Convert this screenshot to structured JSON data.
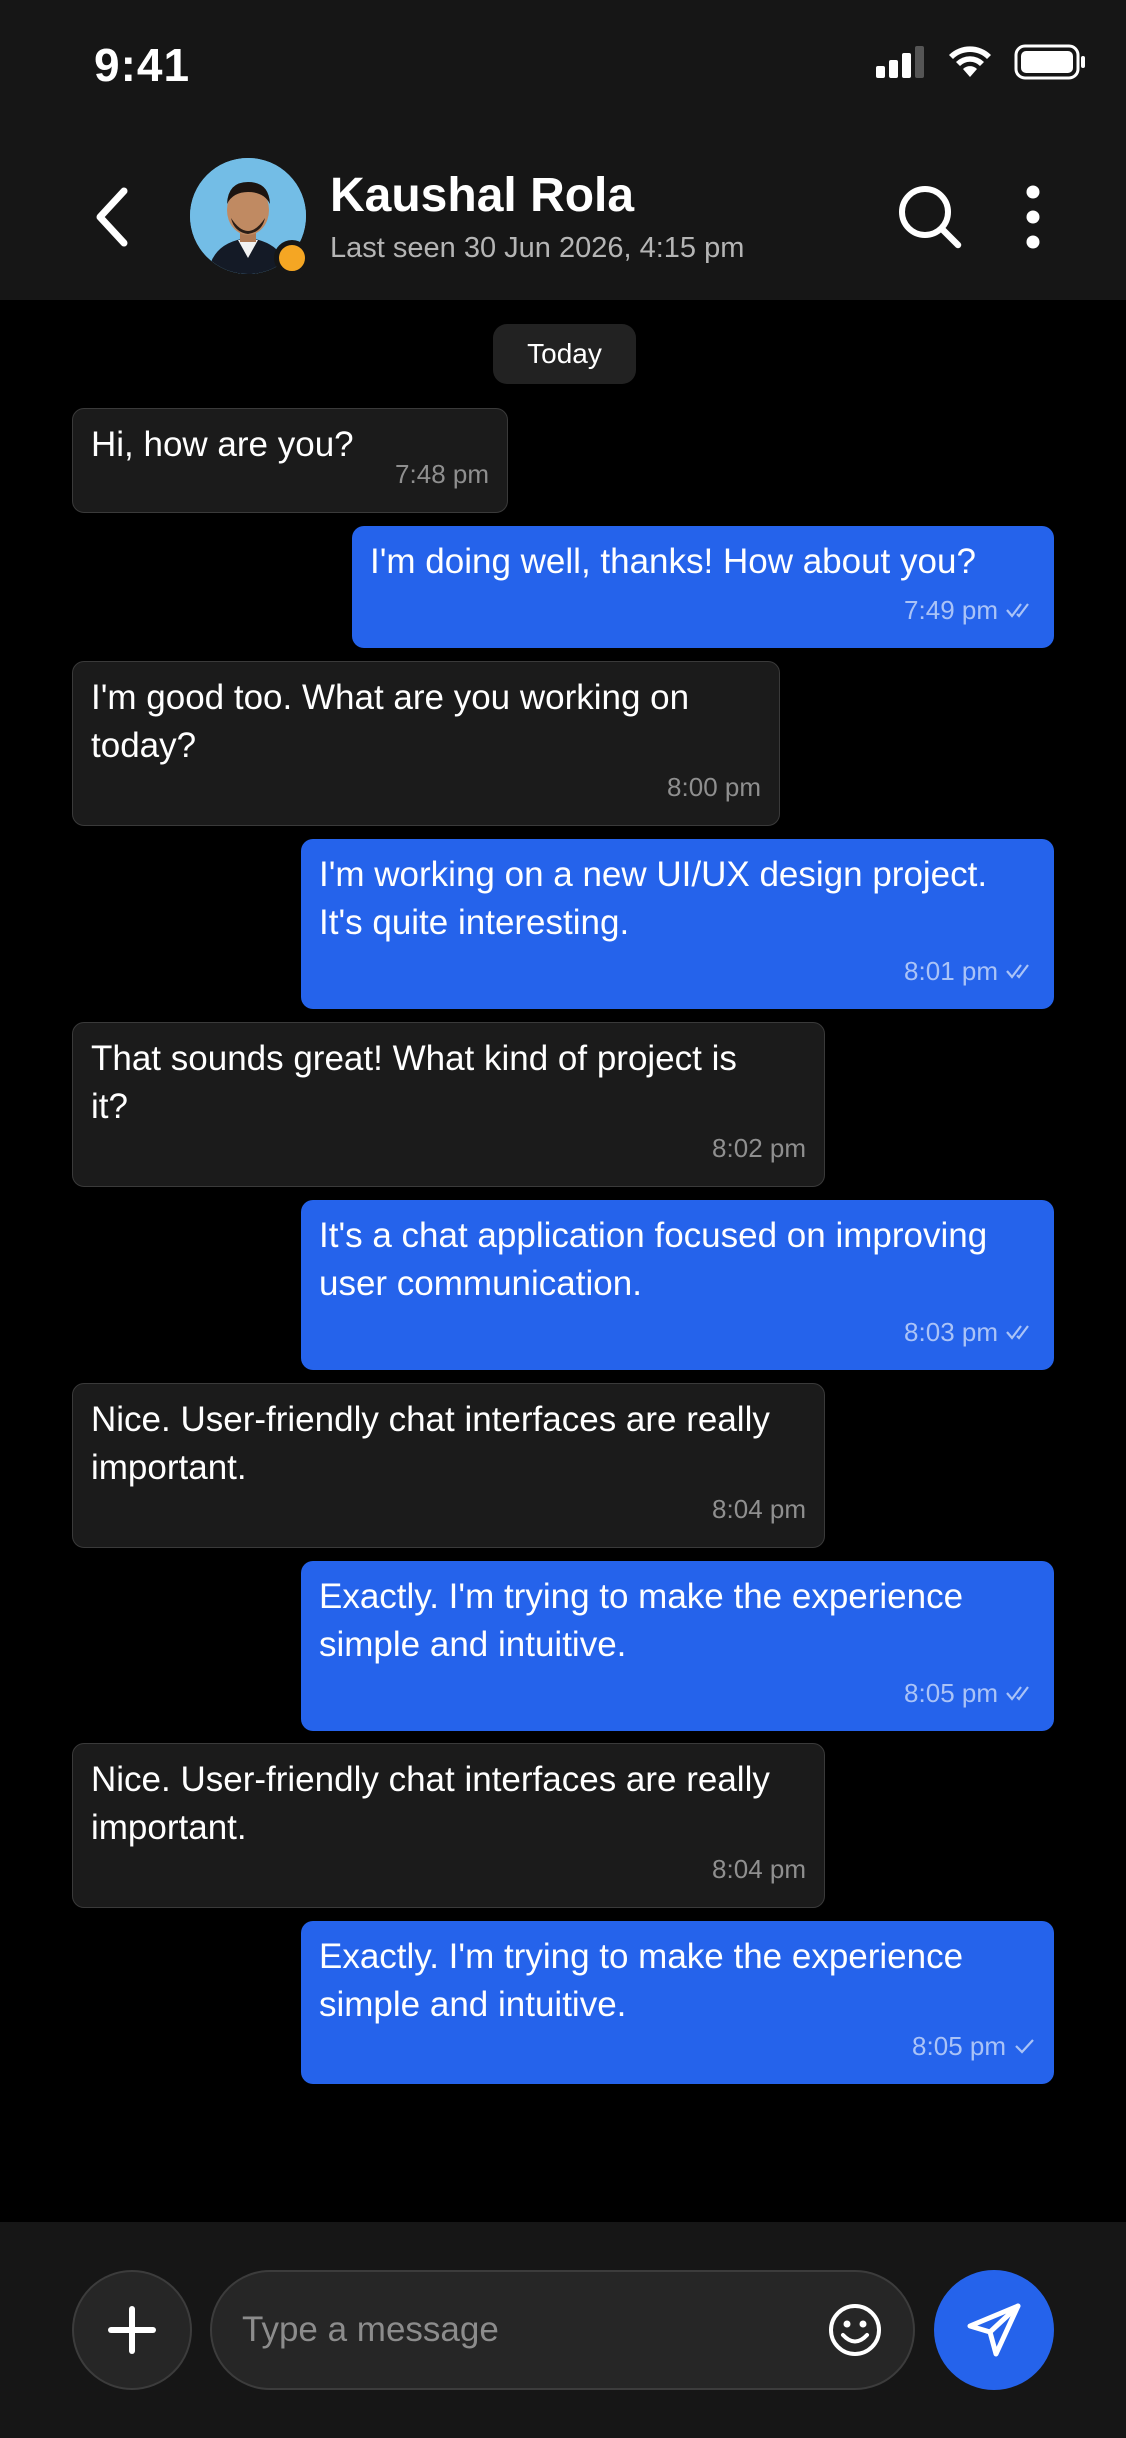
{
  "status_bar": {
    "time": "9:41"
  },
  "header": {
    "contact_name": "Kaushal Rola",
    "last_seen": "Last seen 30 Jun 2026, 4:15 pm"
  },
  "date_chip": "Today",
  "messages": [
    {
      "direction": "incoming",
      "text": "Hi, how are you?",
      "time": "7:48 pm"
    },
    {
      "direction": "outgoing",
      "text": "I'm doing well, thanks! How about you?",
      "time": "7:49 pm",
      "status": "read"
    },
    {
      "direction": "incoming",
      "text": "I'm good too. What are you working on\ntoday?",
      "time": "8:00 pm"
    },
    {
      "direction": "outgoing",
      "text": "I'm working on a new UI/UX design project.\nIt's quite interesting.",
      "time": "8:01 pm",
      "status": "read"
    },
    {
      "direction": "incoming",
      "text": "That sounds great! What kind of project is\nit?",
      "time": "8:02 pm"
    },
    {
      "direction": "outgoing",
      "text": "It's a chat application focused on improving\nuser communication.",
      "time": "8:03 pm",
      "status": "read"
    },
    {
      "direction": "incoming",
      "text": "Nice. User-friendly chat interfaces are really\nimportant.",
      "time": "8:04 pm"
    },
    {
      "direction": "outgoing",
      "text": "Exactly. I'm trying to make the experience\nsimple and intuitive.",
      "time": "8:05 pm",
      "status": "read"
    },
    {
      "direction": "incoming",
      "text": "Nice. User-friendly chat interfaces are really\nimportant.",
      "time": "8:04 pm"
    },
    {
      "direction": "outgoing",
      "text": "Exactly. I'm trying to make the experience\nsimple and intuitive.",
      "time": "8:05 pm",
      "status": "sent"
    }
  ],
  "composer": {
    "placeholder": "Type a message"
  },
  "colors": {
    "accent": "#2563eb",
    "online_dot": "#f5a623",
    "incoming_bubble": "#1b1b1b",
    "background": "#000000",
    "header": "#161616"
  },
  "icons": {
    "back": "chevron-left-icon",
    "search": "search-icon",
    "more": "more-vertical-icon",
    "add": "plus-icon",
    "emoji": "smile-icon",
    "send": "send-icon",
    "read": "double-check-icon",
    "sent": "check-icon"
  }
}
